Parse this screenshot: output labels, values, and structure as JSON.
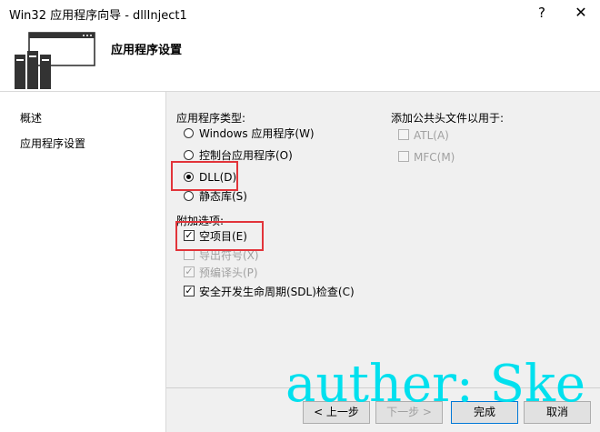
{
  "window": {
    "title": "Win32 应用程序向导 - dllInject1",
    "help_label": "?",
    "close_label": "✕"
  },
  "header": {
    "title": "应用程序设置"
  },
  "nav": {
    "items": [
      {
        "label": "概述"
      },
      {
        "label": "应用程序设置"
      }
    ]
  },
  "app_type": {
    "label": "应用程序类型:",
    "options": [
      {
        "label": "Windows 应用程序(W)",
        "selected": false
      },
      {
        "label": "控制台应用程序(O)",
        "selected": false
      },
      {
        "label": "DLL(D)",
        "selected": true
      },
      {
        "label": "静态库(S)",
        "selected": false
      }
    ]
  },
  "extra_options": {
    "label": "附加选项:",
    "items": [
      {
        "label": "空项目(E)",
        "checked": true,
        "enabled": true
      },
      {
        "label": "导出符号(X)",
        "checked": false,
        "enabled": false
      },
      {
        "label": "预编译头(P)",
        "checked": true,
        "enabled": false
      },
      {
        "label": "安全开发生命周期(SDL)检查(C)",
        "checked": true,
        "enabled": true
      }
    ]
  },
  "common_headers": {
    "label": "添加公共头文件以用于:",
    "items": [
      {
        "label": "ATL(A)",
        "checked": false,
        "enabled": false
      },
      {
        "label": "MFC(M)",
        "checked": false,
        "enabled": false
      }
    ]
  },
  "buttons": {
    "prev": "< 上一步",
    "next": "下一步 >",
    "finish": "完成",
    "cancel": "取消"
  },
  "watermark": "auther: Ske",
  "colors": {
    "highlight_box": "#e2343a",
    "watermark": "#00e0ee",
    "panel_bg": "#f0f0f0"
  }
}
